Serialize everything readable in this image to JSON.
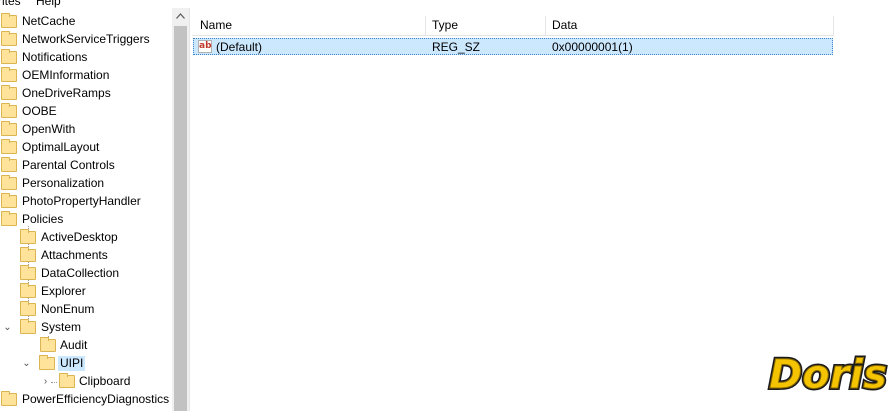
{
  "menu": {
    "favorites": "rites",
    "help": "Help"
  },
  "tree": {
    "items": [
      {
        "label": "NetCache"
      },
      {
        "label": "NetworkServiceTriggers"
      },
      {
        "label": "Notifications"
      },
      {
        "label": "OEMInformation"
      },
      {
        "label": "OneDriveRamps"
      },
      {
        "label": "OOBE"
      },
      {
        "label": "OpenWith"
      },
      {
        "label": "OptimalLayout"
      },
      {
        "label": "Parental Controls"
      },
      {
        "label": "Personalization"
      },
      {
        "label": "PhotoPropertyHandler"
      },
      {
        "label": "Policies"
      },
      {
        "label": "ActiveDesktop"
      },
      {
        "label": "Attachments"
      },
      {
        "label": "DataCollection"
      },
      {
        "label": "Explorer"
      },
      {
        "label": "NonEnum"
      },
      {
        "label": "System"
      },
      {
        "label": "Audit"
      },
      {
        "label": "UIPI"
      },
      {
        "label": "Clipboard"
      },
      {
        "label": "PowerEfficiencyDiagnostics"
      }
    ]
  },
  "columns": {
    "name": "Name",
    "type": "Type",
    "data": "Data"
  },
  "values": [
    {
      "name": "(Default)",
      "type": "REG_SZ",
      "data": "0x00000001(1)"
    }
  ],
  "icons": {
    "value": "ab-string-icon",
    "folder": "folder-icon"
  },
  "watermark": {
    "text": "Doris"
  }
}
